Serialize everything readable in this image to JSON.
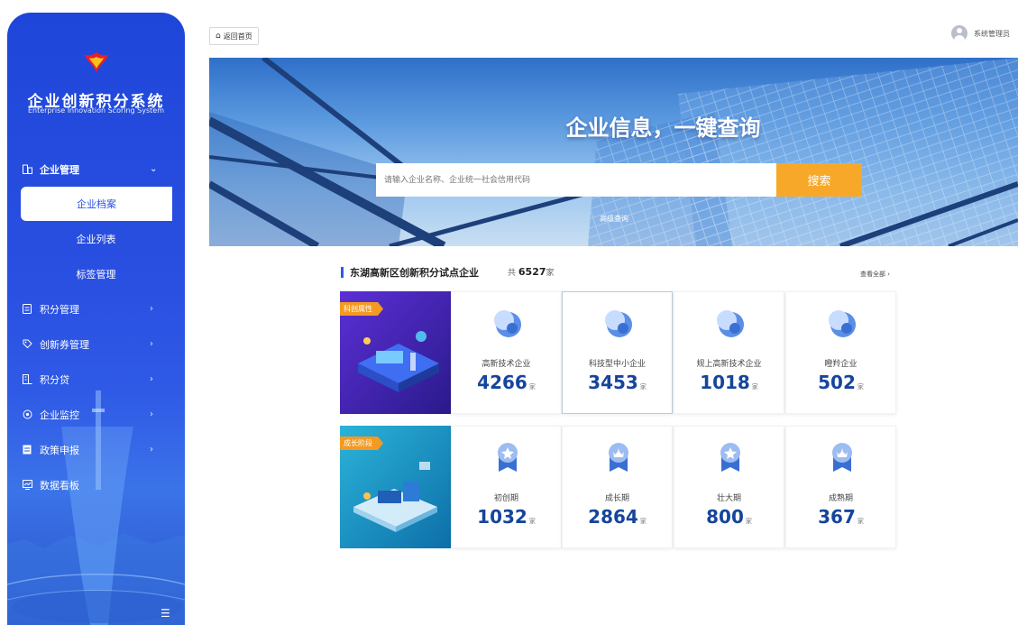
{
  "sidebar": {
    "title": "企业创新积分系统",
    "subtitle": "Enterprise Innovation Scoring System",
    "menu": {
      "enterprise": "企业管理",
      "archive": "企业档案",
      "list": "企业列表",
      "tags": "标签管理",
      "points": "积分管理",
      "vouchers": "创新券管理",
      "loans": "积分贷",
      "monitor": "企业监控",
      "policy": "政策申报",
      "dashboard": "数据看板"
    }
  },
  "topbar": {
    "back_label": "返回首页",
    "user_name": "系统管理员"
  },
  "banner": {
    "title": "企业信息，一键查询",
    "search_placeholder": "请输入企业名称、企业统一社会信用代码",
    "search_button": "搜索",
    "advanced": "高级查询"
  },
  "section": {
    "title": "东湖高新区创新积分试点企业",
    "count_prefix": "共",
    "count_value": "6527",
    "count_unit": "家",
    "view_all": "查看全部 ›"
  },
  "rows": [
    {
      "tag": "科创属性",
      "cards": [
        {
          "label": "高新技术企业",
          "value": "4266",
          "unit": "家"
        },
        {
          "label": "科技型中小企业",
          "value": "3453",
          "unit": "家"
        },
        {
          "label": "规上高新技术企业",
          "value": "1018",
          "unit": "家"
        },
        {
          "label": "瞪羚企业",
          "value": "502",
          "unit": "家"
        }
      ]
    },
    {
      "tag": "成长阶段",
      "cards": [
        {
          "label": "初创期",
          "value": "1032",
          "unit": "家"
        },
        {
          "label": "成长期",
          "value": "2864",
          "unit": "家"
        },
        {
          "label": "壮大期",
          "value": "800",
          "unit": "家"
        },
        {
          "label": "成熟期",
          "value": "367",
          "unit": "家"
        }
      ]
    }
  ],
  "colors": {
    "sidebar": "#2a50e2",
    "accent_orange": "#f8a828",
    "number_blue": "#15459c"
  }
}
